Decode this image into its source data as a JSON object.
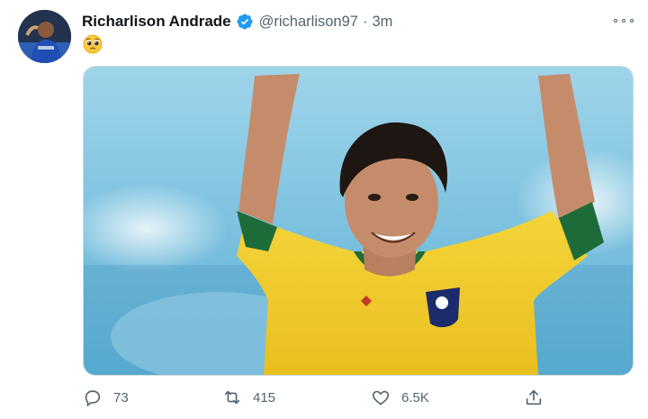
{
  "tweet": {
    "author_name": "Richarlison Andrade",
    "handle": "@richarlison97",
    "separator": "·",
    "time": "3m",
    "emoji": "🥺"
  },
  "actions": {
    "reply_count": "73",
    "retweet_count": "415",
    "like_count": "6.5K"
  },
  "colors": {
    "verified": "#1d9bf0",
    "secondary_text": "#536471",
    "jersey": "#f2cf2a",
    "jersey_trim": "#1e6b3a"
  },
  "icons": [
    "more-icon",
    "verified-icon",
    "reply-icon",
    "retweet-icon",
    "like-icon",
    "share-icon"
  ]
}
